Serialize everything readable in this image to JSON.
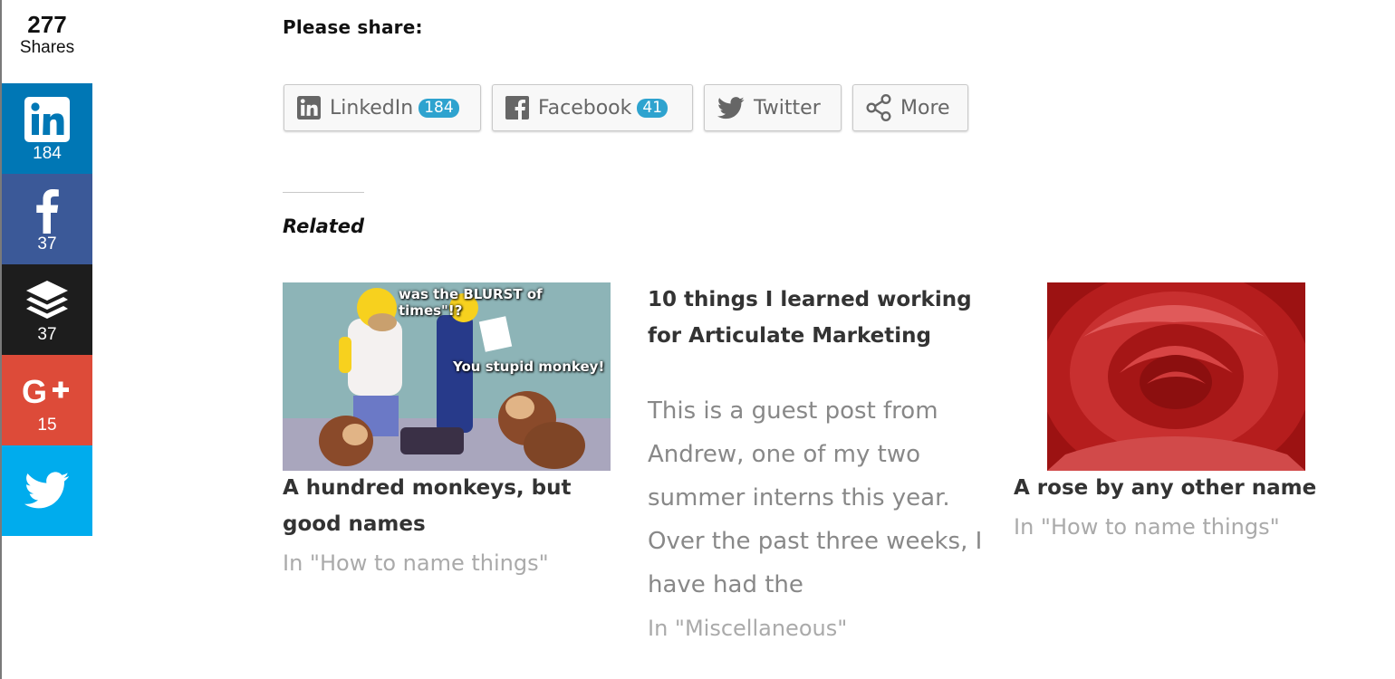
{
  "share_sidebar": {
    "total": "277",
    "total_label": "Shares",
    "buttons": [
      {
        "network": "linkedin",
        "icon": "linkedin-icon",
        "count": "184",
        "color": "#0077b5"
      },
      {
        "network": "facebook",
        "icon": "facebook-icon",
        "count": "37",
        "color": "#3b5998"
      },
      {
        "network": "buffer",
        "icon": "buffer-icon",
        "count": "37",
        "color": "#1d1d1d"
      },
      {
        "network": "google-plus",
        "icon": "google-plus-icon",
        "count": "15",
        "color": "#dd4b39"
      },
      {
        "network": "twitter",
        "icon": "twitter-icon",
        "count": "",
        "color": "#00aced"
      }
    ]
  },
  "share_bar": {
    "heading": "Please share:",
    "buttons": [
      {
        "label": "LinkedIn",
        "icon": "linkedin-icon",
        "count": "184"
      },
      {
        "label": "Facebook",
        "icon": "facebook-icon",
        "count": "41"
      },
      {
        "label": "Twitter",
        "icon": "twitter-icon"
      },
      {
        "label": "More",
        "icon": "share-icon"
      }
    ],
    "badge_color": "#2ea3cf"
  },
  "related": {
    "heading": "Related",
    "posts": [
      {
        "title": "A hundred monkeys, but good names",
        "context": "In \"How to name things\"",
        "image_captions": [
          "was the BLURST of times\"!?",
          "You stupid monkey!"
        ]
      },
      {
        "title": "10 things I learned working for Articulate Marketing",
        "excerpt": "This is a guest post from Andrew, one of my two summer interns this year. Over the past three weeks, I have had the",
        "context": "In \"Miscellaneous\""
      },
      {
        "title": "A rose by any other name",
        "context": "In \"How to name things\""
      }
    ]
  }
}
